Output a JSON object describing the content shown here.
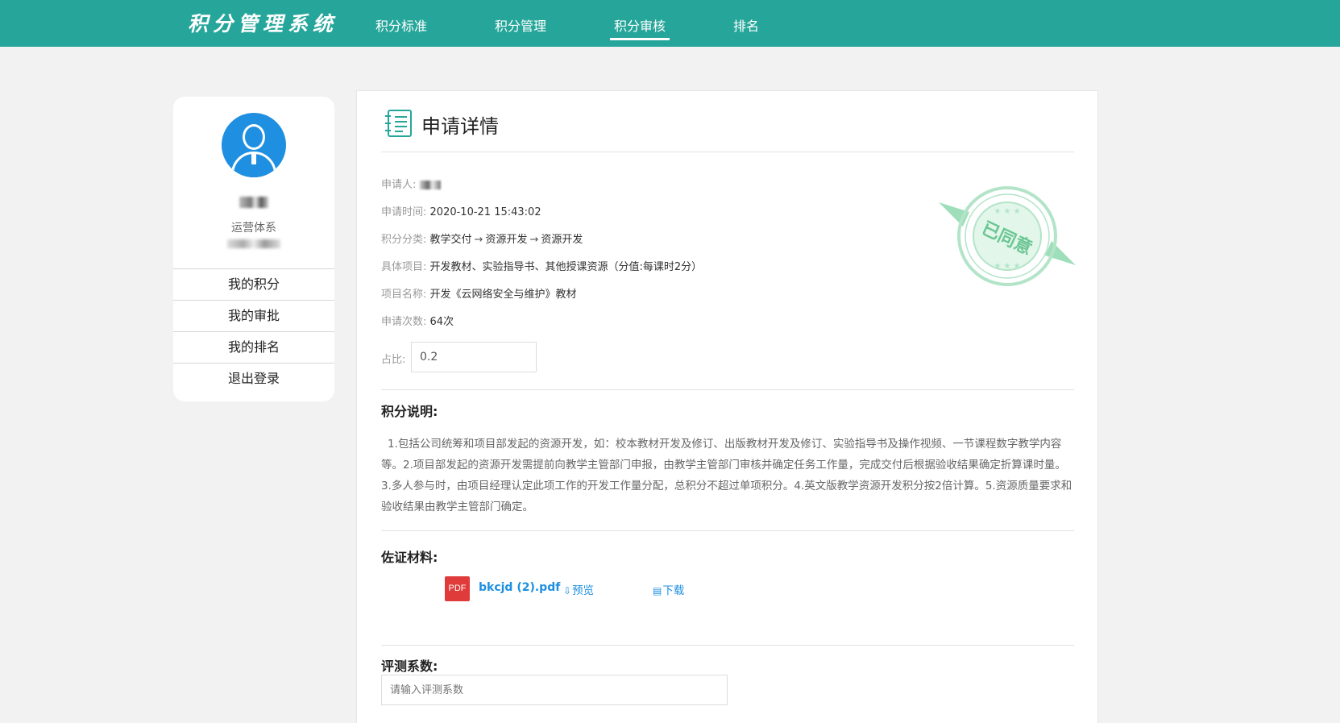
{
  "header": {
    "logo": "积分管理系统",
    "nav": [
      {
        "label": "积分标准"
      },
      {
        "label": "积分管理"
      },
      {
        "label": "积分审核",
        "active": true
      },
      {
        "label": "排名"
      }
    ]
  },
  "profile": {
    "department": "运营体系",
    "menu": [
      {
        "label": "我的积分"
      },
      {
        "label": "我的审批"
      },
      {
        "label": "我的排名"
      },
      {
        "label": "退出登录"
      }
    ]
  },
  "detail": {
    "title": "申请详情",
    "applicant_label": "申请人:",
    "time_label": "申请时间:",
    "time_value": "2020-10-21 15:43:02",
    "category_label": "积分分类:",
    "category_path": [
      "教学交付",
      "资源开发",
      "资源开发"
    ],
    "item_label": "具体项目:",
    "item_value": "开发教材、实验指导书、其他授课资源（分值:每课时2分）",
    "name_label": "项目名称:",
    "name_value": "开发《云网络安全与维护》教材",
    "count_label": "申请次数:",
    "count_value": "64次",
    "ratio_label": "占比:",
    "ratio_value": "0.2",
    "stamp_text": "已同意",
    "stamp_color": "#3cb371"
  },
  "explanation": {
    "title": "积分说明:",
    "text": "1.包括公司统筹和项目部发起的资源开发，如：校本教材开发及修订、出版教材开发及修订、实验指导书及操作视频、一节课程数字教学内容等。2.项目部发起的资源开发需提前向教学主管部门申报，由教学主管部门审核并确定任务工作量，完成交付后根据验收结果确定折算课时量。3.多人参与时，由项目经理认定此项工作的开发工作量分配，总积分不超过单项积分。4.英文版教学资源开发积分按2倍计算。5.资源质量要求和验收结果由教学主管部门确定。"
  },
  "evidence": {
    "title": "佐证材料:",
    "file_badge": "PDF",
    "file_name": "bkcjd (2).pdf",
    "preview_label": "预览",
    "download_label": "下载"
  },
  "evaluation": {
    "title": "评测系数:",
    "placeholder": "请输入评测系数"
  },
  "colors": {
    "primary": "#26a69a",
    "link": "#1e8fe1",
    "pdf": "#e03b3b"
  }
}
